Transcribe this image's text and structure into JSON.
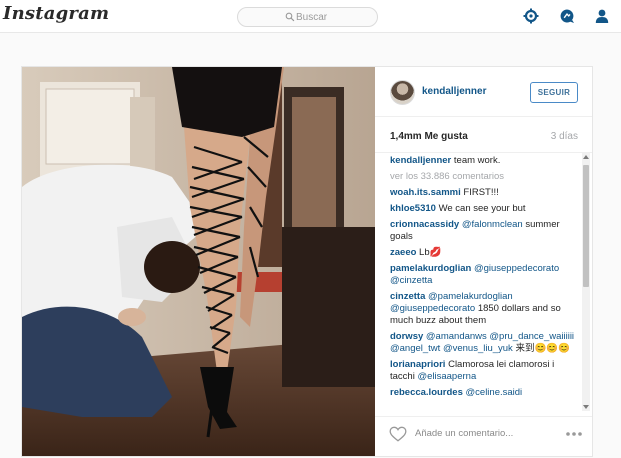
{
  "topbar": {
    "logo_text": "Instagram",
    "search": {
      "placeholder": "Buscar"
    },
    "icons": [
      "explore-icon",
      "activity-icon",
      "profile-icon"
    ]
  },
  "post": {
    "username": "kendalljenner",
    "follow_label": "SEGUIR",
    "likes": "1,4mm Me gusta",
    "timestamp": "3 días",
    "caption_user": "kendalljenner",
    "caption_text": "team work.",
    "view_all_comments": "ver los 33.886 comentarios",
    "comments": [
      {
        "user": "woah.its.sammi",
        "text": "FIRST!!!"
      },
      {
        "user": "khloe5310",
        "text": "We can see your but"
      },
      {
        "user": "crionnacassidy",
        "mention": "@falonmclean",
        "text": " summer goals"
      },
      {
        "user": "zaeeo",
        "text": "Lb💋"
      },
      {
        "user": "pamelakurdoglian",
        "mention": "@giuseppedecorato @cinzetta",
        "text": ""
      },
      {
        "user": "cinzetta",
        "mention": "@pamelakurdoglian @giuseppedecorato",
        "text": " 1850 dollars and so much buzz about them"
      },
      {
        "user": "dorwsy",
        "mention": "@amandanws @pru_dance_waiiiiii @angel_twt @venus_liu_yuk",
        "text": " 来到😊😊😊"
      },
      {
        "user": "lorianapriori",
        "text": "Clamorosa lei clamorosi i tacchi ",
        "mention_after": "@elisaaperna"
      },
      {
        "user": "rebecca.lourdes",
        "mention": "@celine.saidi",
        "text": ""
      }
    ],
    "comment_input_placeholder": "Añade un comentario..."
  },
  "colors": {
    "link_blue": "#125688",
    "follow_border": "#4a8ac7",
    "muted_gray": "#a5a7aa"
  }
}
